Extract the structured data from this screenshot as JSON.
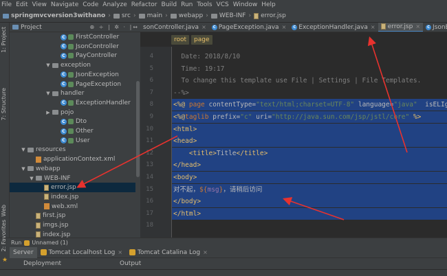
{
  "menu": [
    "File",
    "Edit",
    "View",
    "Navigate",
    "Code",
    "Analyze",
    "Refactor",
    "Build",
    "Run",
    "Tools",
    "VCS",
    "Window",
    "Help"
  ],
  "breadcrumbs": [
    "springmvcversion3withano",
    "src",
    "main",
    "webapp",
    "WEB-INF",
    "error.jsp"
  ],
  "side_tabs": {
    "project": "1: Project",
    "structure": "7: Structure",
    "web": "Web",
    "favorites": "2: Favorites"
  },
  "project_panel": {
    "title": "Project",
    "tools": "⊕ ÷ | ✲ · |↔"
  },
  "tree": [
    {
      "label": "FirstController",
      "icon": "class-icon",
      "indent": 5,
      "arrow": ""
    },
    {
      "label": "JsonController",
      "icon": "class-icon",
      "indent": 5,
      "arrow": ""
    },
    {
      "label": "PayController",
      "icon": "class-icon",
      "indent": 5,
      "arrow": ""
    },
    {
      "label": "exception",
      "icon": "folder-icon",
      "indent": 4,
      "arrow": "▼"
    },
    {
      "label": "JsonException",
      "icon": "class-icon",
      "indent": 5,
      "arrow": ""
    },
    {
      "label": "PageException",
      "icon": "class-icon",
      "indent": 5,
      "arrow": ""
    },
    {
      "label": "handler",
      "icon": "folder-icon",
      "indent": 4,
      "arrow": "▼"
    },
    {
      "label": "ExceptionHandler",
      "icon": "class-icon",
      "indent": 5,
      "arrow": ""
    },
    {
      "label": "pojo",
      "icon": "folder-icon",
      "indent": 4,
      "arrow": "▶"
    },
    {
      "label": "Dto",
      "icon": "class-icon",
      "indent": 5,
      "arrow": ""
    },
    {
      "label": "Other",
      "icon": "class-icon",
      "indent": 5,
      "arrow": ""
    },
    {
      "label": "User",
      "icon": "class-icon",
      "indent": 5,
      "arrow": ""
    },
    {
      "label": "resources",
      "icon": "folder-icon",
      "indent": 1,
      "arrow": "▼"
    },
    {
      "label": "applicationContext.xml",
      "icon": "xml-icon",
      "indent": 2,
      "arrow": ""
    },
    {
      "label": "webapp",
      "icon": "folder-icon",
      "indent": 1,
      "arrow": "▼"
    },
    {
      "label": "WEB-INF",
      "icon": "folder-icon",
      "indent": 2,
      "arrow": "▼"
    },
    {
      "label": "error.jsp",
      "icon": "jsp-icon",
      "indent": 3,
      "arrow": "",
      "selected": true
    },
    {
      "label": "index.jsp",
      "icon": "jsp-icon",
      "indent": 3,
      "arrow": ""
    },
    {
      "label": "web.xml",
      "icon": "xml-icon",
      "indent": 3,
      "arrow": ""
    },
    {
      "label": "first.jsp",
      "icon": "jsp-icon",
      "indent": 2,
      "arrow": ""
    },
    {
      "label": "imgs.jsp",
      "icon": "jsp-icon",
      "indent": 2,
      "arrow": ""
    },
    {
      "label": "index.jsp",
      "icon": "jsp-icon",
      "indent": 2,
      "arrow": ""
    }
  ],
  "editor_tabs": [
    {
      "label": "sonController.java",
      "icon": "",
      "active": false
    },
    {
      "label": "PageException.java",
      "icon": "class-icon",
      "active": false
    },
    {
      "label": "ExceptionHandler.java",
      "icon": "class-icon",
      "active": false
    },
    {
      "label": "error.jsp",
      "icon": "jsp-icon",
      "active": true
    },
    {
      "label": "JsonException.java",
      "icon": "class-icon",
      "active": false
    }
  ],
  "path_chips": [
    "root",
    "page"
  ],
  "lines": [
    {
      "n": "4",
      "hl": false,
      "parts": [
        {
          "c": "cm",
          "t": "  Date: 2018/8/10"
        }
      ]
    },
    {
      "n": "5",
      "hl": false,
      "parts": [
        {
          "c": "cm",
          "t": "  Time: 19:17"
        }
      ]
    },
    {
      "n": "6",
      "hl": false,
      "parts": [
        {
          "c": "cm",
          "t": "  To change this template use File | Settings | File Templates."
        }
      ]
    },
    {
      "n": "7",
      "hl": false,
      "parts": [
        {
          "c": "cm",
          "t": "--%>"
        }
      ]
    },
    {
      "n": "8",
      "hl": true,
      "parts": [
        {
          "c": "tag",
          "t": "<%@ "
        },
        {
          "c": "kw",
          "t": "page "
        },
        {
          "c": "attr",
          "t": "contentType="
        },
        {
          "c": "str",
          "t": "\"text/html;charset=UTF-8\""
        },
        {
          "c": "attr",
          "t": " language="
        },
        {
          "c": "str",
          "t": "\"java\""
        },
        {
          "c": "attr",
          "t": "  isELIgnored="
        },
        {
          "c": "str",
          "t": "\""
        }
      ]
    },
    {
      "n": "9",
      "hl": true,
      "parts": [
        {
          "c": "tag",
          "t": "<%@"
        },
        {
          "c": "kw",
          "t": "taglib "
        },
        {
          "c": "attr",
          "t": "prefix="
        },
        {
          "c": "str",
          "t": "\"c\""
        },
        {
          "c": "attr",
          "t": " uri="
        },
        {
          "c": "str",
          "t": "\"http://java.sun.com/jsp/jstl/core\""
        },
        {
          "c": "tag",
          "t": " %>"
        }
      ]
    },
    {
      "n": "10",
      "hl": true,
      "parts": [
        {
          "c": "tag",
          "t": "<html>"
        }
      ]
    },
    {
      "n": "11",
      "hl": true,
      "parts": [
        {
          "c": "tag",
          "t": "<head>"
        }
      ]
    },
    {
      "n": "12",
      "hl": true,
      "parts": [
        {
          "c": "tag",
          "t": "    <title>"
        },
        {
          "c": "txt",
          "t": "Title"
        },
        {
          "c": "tag",
          "t": "</title>"
        }
      ]
    },
    {
      "n": "13",
      "hl": true,
      "parts": [
        {
          "c": "tag",
          "t": "</head>"
        }
      ]
    },
    {
      "n": "14",
      "hl": true,
      "parts": [
        {
          "c": "tag",
          "t": "<body>"
        }
      ]
    },
    {
      "n": "15",
      "hl": true,
      "parts": [
        {
          "c": "txt",
          "t": "对不起，"
        },
        {
          "c": "kw",
          "t": "${"
        },
        {
          "c": "el",
          "t": "msg"
        },
        {
          "c": "kw",
          "t": "}"
        },
        {
          "c": "txt",
          "t": "，请稍后访问"
        }
      ]
    },
    {
      "n": "16",
      "hl": true,
      "parts": [
        {
          "c": "tag",
          "t": "</body>"
        }
      ]
    },
    {
      "n": "17",
      "hl": true,
      "parts": [
        {
          "c": "tag",
          "t": "</html>"
        }
      ]
    },
    {
      "n": "18",
      "hl": false,
      "parts": []
    }
  ],
  "run": {
    "label": "Run",
    "config": "Unnamed (1)",
    "tabs": [
      {
        "label": "Server",
        "active": true,
        "icon": ""
      },
      {
        "label": "Tomcat Localhost Log",
        "active": false,
        "icon": "tomcat-icon"
      },
      {
        "label": "Tomcat Catalina Log",
        "active": false,
        "icon": "tomcat-icon"
      }
    ],
    "columns": [
      "Deployment",
      "Output"
    ]
  }
}
